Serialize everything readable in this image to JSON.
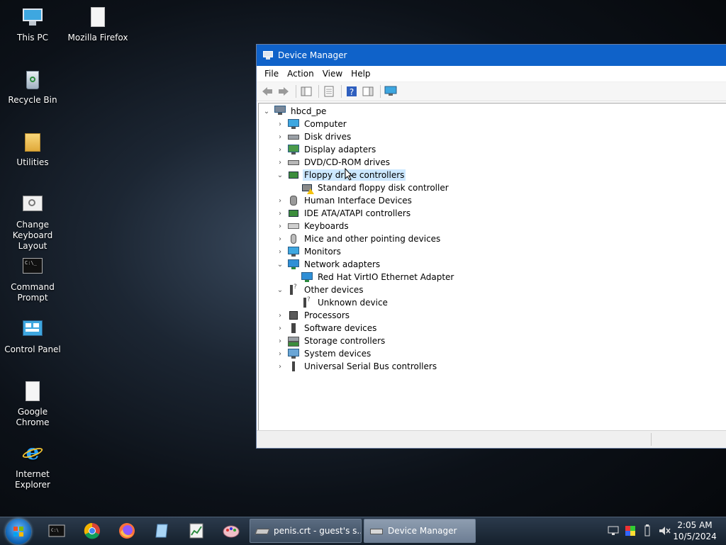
{
  "desktop": {
    "icons": [
      {
        "label": "This PC"
      },
      {
        "label": "Mozilla Firefox"
      },
      {
        "label": "Recycle Bin"
      },
      {
        "label": "Utilities"
      },
      {
        "label": "Change Keyboard Layout"
      },
      {
        "label": "Command Prompt"
      },
      {
        "label": "Control Panel"
      },
      {
        "label": "Google Chrome"
      },
      {
        "label": "Internet Explorer"
      }
    ]
  },
  "window": {
    "title": "Device Manager",
    "menu": [
      "File",
      "Action",
      "View",
      "Help"
    ],
    "tree": {
      "root": "hbcd_pe",
      "items": [
        {
          "label": "Computer"
        },
        {
          "label": "Disk drives"
        },
        {
          "label": "Display adapters"
        },
        {
          "label": "DVD/CD-ROM drives"
        },
        {
          "label": "Floppy drive controllers"
        },
        {
          "label": "Standard floppy disk controller"
        },
        {
          "label": "Human Interface Devices"
        },
        {
          "label": "IDE ATA/ATAPI controllers"
        },
        {
          "label": "Keyboards"
        },
        {
          "label": "Mice and other pointing devices"
        },
        {
          "label": "Monitors"
        },
        {
          "label": "Network adapters"
        },
        {
          "label": "Red Hat VirtIO Ethernet Adapter"
        },
        {
          "label": "Other devices"
        },
        {
          "label": "Unknown device"
        },
        {
          "label": "Processors"
        },
        {
          "label": "Software devices"
        },
        {
          "label": "Storage controllers"
        },
        {
          "label": "System devices"
        },
        {
          "label": "Universal Serial Bus controllers"
        }
      ]
    }
  },
  "taskbar": {
    "buttons": [
      {
        "label": "penis.crt - guest's s..."
      },
      {
        "label": "Device Manager"
      }
    ],
    "clock": {
      "time": "2:05 AM",
      "date": "10/5/2024"
    }
  },
  "colors": {
    "titlebar": "#0f62c9",
    "selection": "#cce8ff",
    "taskbar": "#1f2c3a"
  }
}
